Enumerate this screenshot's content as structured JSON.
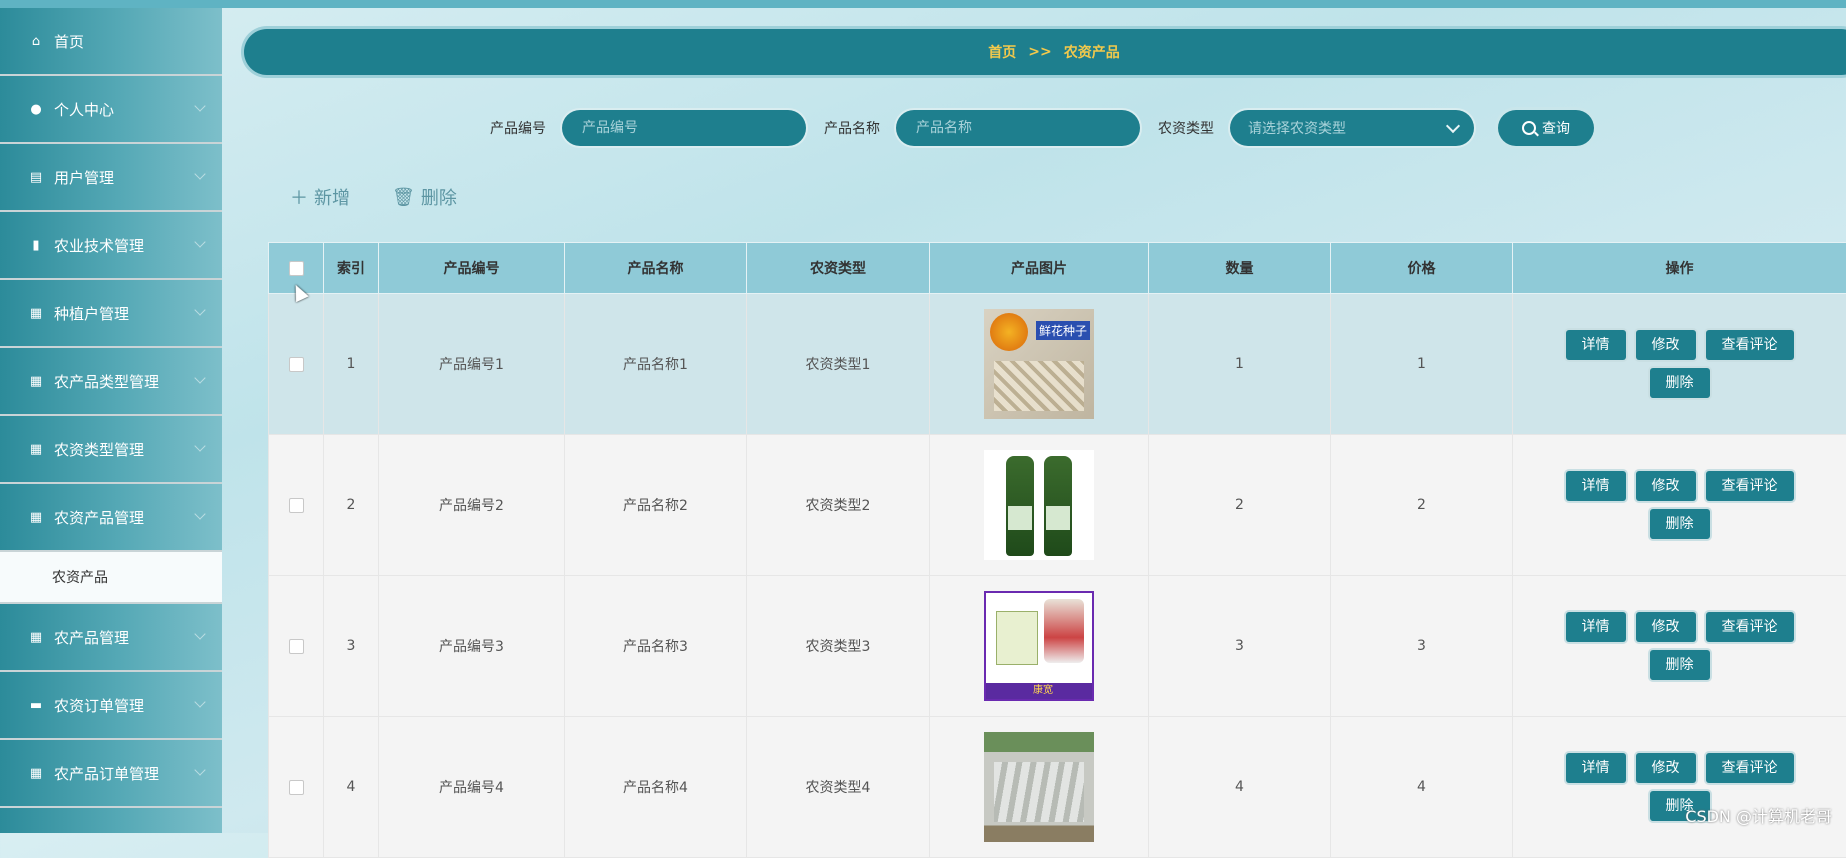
{
  "sidebar": {
    "items": [
      {
        "label": "首页",
        "icon": "home-icon",
        "glyph": "⌂"
      },
      {
        "label": "个人中心",
        "icon": "user-icon",
        "glyph": "●"
      },
      {
        "label": "用户管理",
        "icon": "clipboard-icon",
        "glyph": "▤"
      },
      {
        "label": "农业技术管理",
        "icon": "chart-icon",
        "glyph": "▮"
      },
      {
        "label": "种植户管理",
        "icon": "grid-icon",
        "glyph": "▦"
      },
      {
        "label": "农产品类型管理",
        "icon": "grid-icon",
        "glyph": "▦"
      },
      {
        "label": "农资类型管理",
        "icon": "grid-icon",
        "glyph": "▦"
      },
      {
        "label": "农资产品管理",
        "icon": "grid-icon",
        "glyph": "▦"
      }
    ],
    "active_sub": "农资产品",
    "items_after": [
      {
        "label": "农产品管理",
        "icon": "grid-icon",
        "glyph": "▦"
      },
      {
        "label": "农资订单管理",
        "icon": "monitor-icon",
        "glyph": "▬"
      },
      {
        "label": "农产品订单管理",
        "icon": "grid-icon",
        "glyph": "▦"
      }
    ]
  },
  "breadcrumb": {
    "home": "首页",
    "sep": ">>",
    "current": "农资产品"
  },
  "search": {
    "code_label": "产品编号",
    "code_placeholder": "产品编号",
    "name_label": "产品名称",
    "name_placeholder": "产品名称",
    "type_label": "农资类型",
    "type_placeholder": "请选择农资类型",
    "query_label": "查询"
  },
  "toolbar": {
    "add_label": "新增",
    "delete_label": "删除"
  },
  "table": {
    "headers": [
      "",
      "索引",
      "产品编号",
      "产品名称",
      "农资类型",
      "产品图片",
      "数量",
      "价格",
      "操作"
    ],
    "rows": [
      {
        "index": "1",
        "code": "产品编号1",
        "name": "产品名称1",
        "type": "农资类型1",
        "qty": "1",
        "price": "1",
        "img_text": "鲜花种子"
      },
      {
        "index": "2",
        "code": "产品编号2",
        "name": "产品名称2",
        "type": "农资类型2",
        "qty": "2",
        "price": "2",
        "img_text": ""
      },
      {
        "index": "3",
        "code": "产品编号3",
        "name": "产品名称3",
        "type": "农资类型3",
        "qty": "3",
        "price": "3",
        "img_text": "康宽"
      },
      {
        "index": "4",
        "code": "产品编号4",
        "name": "产品名称4",
        "type": "农资类型4",
        "qty": "4",
        "price": "4",
        "img_text": ""
      }
    ],
    "ops": {
      "detail": "详情",
      "edit": "修改",
      "reviews": "查看评论",
      "delete": "删除"
    }
  },
  "watermark": "CSDN @计算机老哥"
}
